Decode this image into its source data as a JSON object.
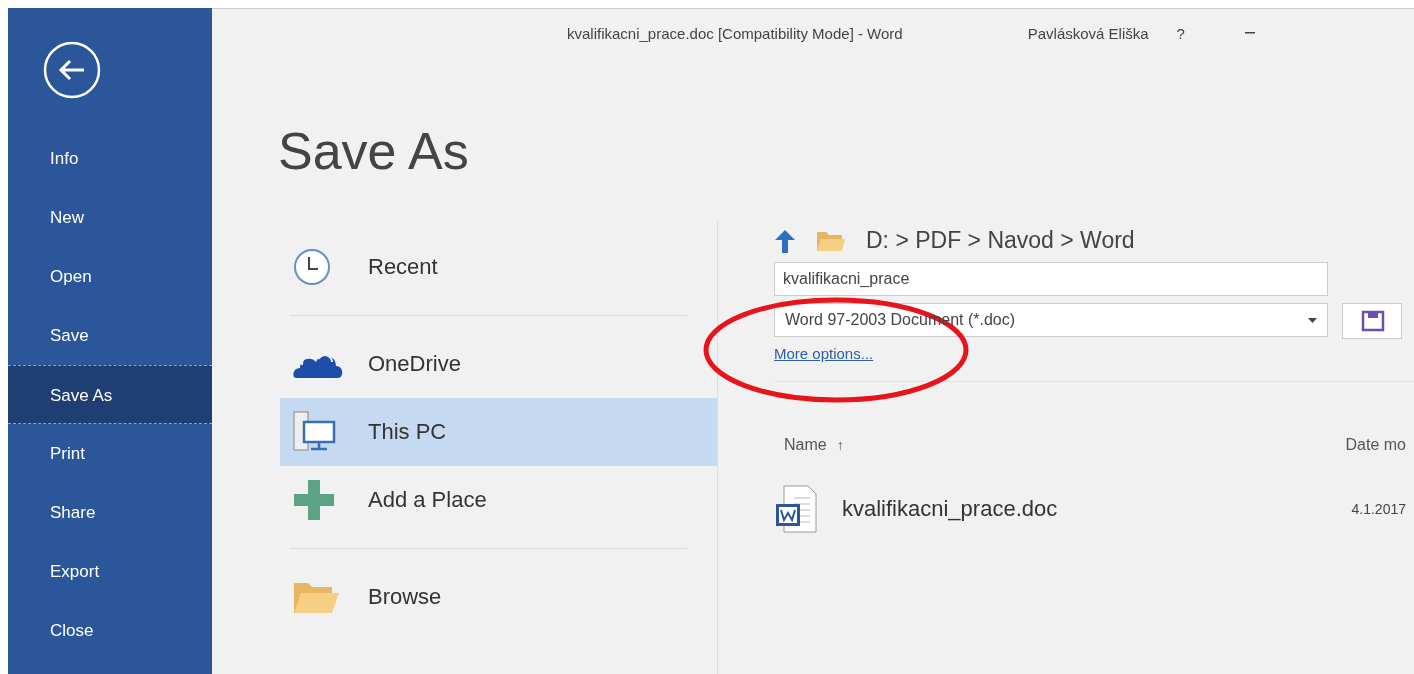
{
  "window": {
    "title": "kvalifikacni_prace.doc [Compatibility Mode]  -  Word",
    "user": "Pavlásková Eliška",
    "help": "?"
  },
  "sidebar": {
    "items": [
      {
        "label": "Info",
        "selected": false
      },
      {
        "label": "New",
        "selected": false
      },
      {
        "label": "Open",
        "selected": false
      },
      {
        "label": "Save",
        "selected": false
      },
      {
        "label": "Save As",
        "selected": true
      },
      {
        "label": "Print",
        "selected": false
      },
      {
        "label": "Share",
        "selected": false
      },
      {
        "label": "Export",
        "selected": false
      },
      {
        "label": "Close",
        "selected": false
      }
    ]
  },
  "heading": "Save As",
  "places": [
    {
      "kind": "recent",
      "label": "Recent",
      "selected": false
    },
    {
      "kind": "onedrive",
      "label": "OneDrive",
      "selected": false
    },
    {
      "kind": "pc",
      "label": "This PC",
      "selected": true
    },
    {
      "kind": "add",
      "label": "Add a Place",
      "selected": false
    },
    {
      "kind": "browse",
      "label": "Browse",
      "selected": false
    }
  ],
  "location": {
    "path": "D: > PDF > Navod > Word"
  },
  "file_name": {
    "value": "kvalifikacni_prace"
  },
  "file_type": {
    "value": "Word 97-2003 Document (*.doc)"
  },
  "more_options": "More options...",
  "files": {
    "columns": [
      "Name",
      "Date mo"
    ],
    "sort_mark": "↑",
    "rows": [
      {
        "name": "kvalifikacni_prace.doc",
        "date": "4.1.2017"
      }
    ]
  },
  "annotation": {
    "kind": "ellipse"
  }
}
